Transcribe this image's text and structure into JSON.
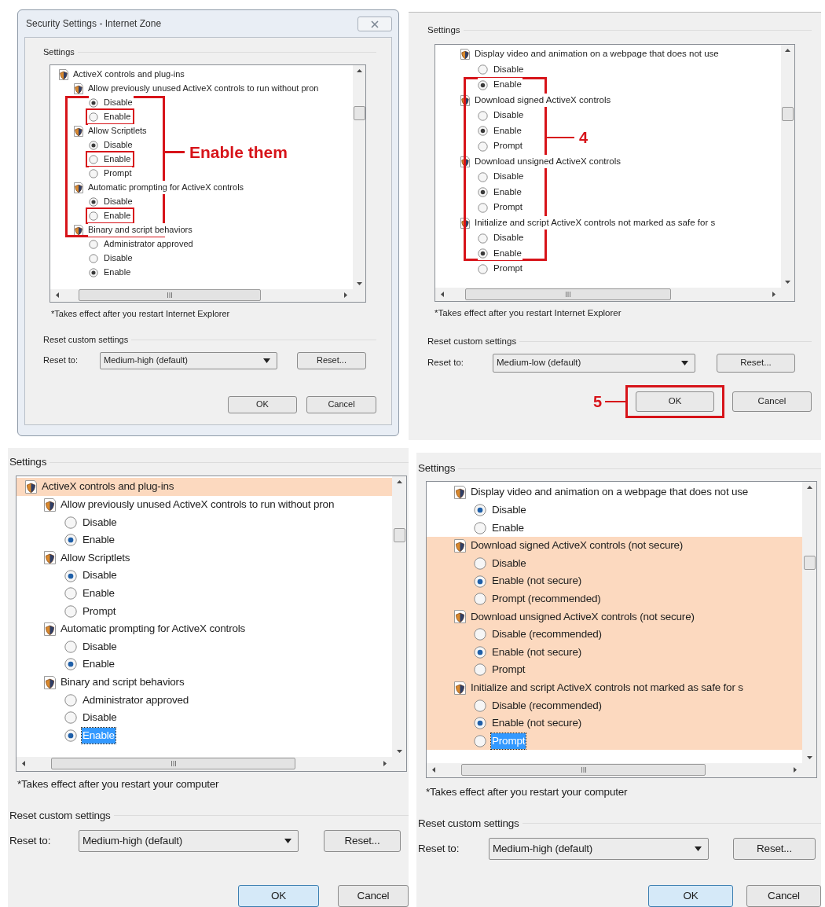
{
  "panels": [
    {
      "kind": "dialog",
      "title": "Security Settings - Internet Zone",
      "settings_label": "Settings",
      "tree": [
        {
          "kind": "group",
          "label": "ActiveX controls and plug-ins",
          "children": [
            {
              "kind": "setting",
              "label": "Allow previously unused ActiveX controls to run without pron",
              "children": [
                {
                  "kind": "option",
                  "label": "Disable",
                  "selected": true,
                  "bracket_start": true
                },
                {
                  "kind": "option",
                  "label": "Enable",
                  "selected": false,
                  "outlined": true
                }
              ]
            },
            {
              "kind": "setting",
              "label": "Allow Scriptlets",
              "children": [
                {
                  "kind": "option",
                  "label": "Disable",
                  "selected": true
                },
                {
                  "kind": "option",
                  "label": "Enable",
                  "selected": false,
                  "outlined": true
                },
                {
                  "kind": "option",
                  "label": "Prompt",
                  "selected": false
                }
              ]
            },
            {
              "kind": "setting",
              "label": "Automatic prompting for ActiveX controls",
              "children": [
                {
                  "kind": "option",
                  "label": "Disable",
                  "selected": true
                },
                {
                  "kind": "option",
                  "label": "Enable",
                  "selected": false,
                  "outlined": true
                }
              ]
            },
            {
              "kind": "setting",
              "label": "Binary and script behaviors",
              "bracket_end": true,
              "children": [
                {
                  "kind": "option",
                  "label": "Administrator approved",
                  "selected": false
                },
                {
                  "kind": "option",
                  "label": "Disable",
                  "selected": false
                },
                {
                  "kind": "option",
                  "label": "Enable",
                  "selected": true
                }
              ]
            }
          ]
        }
      ],
      "annotation": "Enable them",
      "note": "*Takes effect after you restart Internet Explorer",
      "reset_group": "Reset custom settings",
      "reset_label": "Reset to:",
      "reset_level": "Medium-high (default)",
      "reset_button": "Reset...",
      "ok": {
        "label": "OK",
        "default": false
      },
      "cancel": "Cancel"
    },
    {
      "kind": "pane",
      "settings_label": "Settings",
      "tree": [
        {
          "kind": "setting",
          "label": "Display video and animation on a webpage that does not use",
          "children": [
            {
              "kind": "option",
              "label": "Disable",
              "selected": false
            },
            {
              "kind": "option",
              "label": "Enable",
              "selected": true,
              "bracket_start": true
            }
          ]
        },
        {
          "kind": "setting",
          "label": "Download signed ActiveX controls",
          "children": [
            {
              "kind": "option",
              "label": "Disable",
              "selected": false
            },
            {
              "kind": "option",
              "label": "Enable",
              "selected": true
            },
            {
              "kind": "option",
              "label": "Prompt",
              "selected": false
            }
          ]
        },
        {
          "kind": "setting",
          "label": "Download unsigned ActiveX controls",
          "children": [
            {
              "kind": "option",
              "label": "Disable",
              "selected": false
            },
            {
              "kind": "option",
              "label": "Enable",
              "selected": true
            },
            {
              "kind": "option",
              "label": "Prompt",
              "selected": false
            }
          ]
        },
        {
          "kind": "setting",
          "label": "Initialize and script ActiveX controls not marked as safe for s",
          "children": [
            {
              "kind": "option",
              "label": "Disable",
              "selected": false
            },
            {
              "kind": "option",
              "label": "Enable",
              "selected": true,
              "bracket_end": true
            },
            {
              "kind": "option",
              "label": "Prompt",
              "selected": false
            }
          ]
        }
      ],
      "annotation": "4",
      "note": "*Takes effect after you restart Internet Explorer",
      "reset_group": "Reset custom settings",
      "reset_label": "Reset to:",
      "reset_level": "Medium-low (default)",
      "reset_button": "Reset...",
      "ok": {
        "label": "OK",
        "default": false,
        "annotation": "5"
      },
      "cancel": "Cancel"
    },
    {
      "kind": "pane",
      "settings_label": "Settings",
      "tree": [
        {
          "kind": "group",
          "label": "ActiveX controls and plug-ins",
          "highlighted": true,
          "children": [
            {
              "kind": "setting",
              "label": "Allow previously unused ActiveX controls to run without pron",
              "highlighted": false,
              "children": [
                {
                  "kind": "option",
                  "label": "Disable",
                  "selected": false,
                  "highlighted": false
                },
                {
                  "kind": "option",
                  "label": "Enable",
                  "selected": true,
                  "highlighted": false
                }
              ]
            },
            {
              "kind": "setting",
              "label": "Allow Scriptlets",
              "highlighted": false,
              "children": [
                {
                  "kind": "option",
                  "label": "Disable",
                  "selected": true,
                  "highlighted": false
                },
                {
                  "kind": "option",
                  "label": "Enable",
                  "selected": false,
                  "highlighted": false
                },
                {
                  "kind": "option",
                  "label": "Prompt",
                  "selected": false,
                  "highlighted": false
                }
              ]
            },
            {
              "kind": "setting",
              "label": "Automatic prompting for ActiveX controls",
              "highlighted": false,
              "children": [
                {
                  "kind": "option",
                  "label": "Disable",
                  "selected": false,
                  "highlighted": false
                },
                {
                  "kind": "option",
                  "label": "Enable",
                  "selected": true,
                  "highlighted": false
                }
              ]
            },
            {
              "kind": "setting",
              "label": "Binary and script behaviors",
              "highlighted": false,
              "children": [
                {
                  "kind": "option",
                  "label": "Administrator approved",
                  "selected": false,
                  "highlighted": false
                },
                {
                  "kind": "option",
                  "label": "Disable",
                  "selected": false,
                  "highlighted": false
                },
                {
                  "kind": "option",
                  "label": "Enable",
                  "selected": true,
                  "highlighted": false,
                  "focused": true
                }
              ]
            }
          ]
        }
      ],
      "note": "*Takes effect after you restart your computer",
      "reset_group": "Reset custom settings",
      "reset_label": "Reset to:",
      "reset_level": "Medium-high (default)",
      "reset_button": "Reset...",
      "ok": {
        "label": "OK",
        "default": true
      },
      "cancel": "Cancel"
    },
    {
      "kind": "pane",
      "settings_label": "Settings",
      "tree": [
        {
          "kind": "setting",
          "label": "Display video and animation on a webpage that does not use",
          "highlighted": false,
          "children": [
            {
              "kind": "option",
              "label": "Disable",
              "selected": true,
              "highlighted": false
            },
            {
              "kind": "option",
              "label": "Enable",
              "selected": false,
              "highlighted": false
            }
          ]
        },
        {
          "kind": "setting",
          "label": "Download signed ActiveX controls (not secure)",
          "highlighted": true,
          "children": [
            {
              "kind": "option",
              "label": "Disable",
              "selected": false,
              "highlighted": true
            },
            {
              "kind": "option",
              "label": "Enable (not secure)",
              "selected": true,
              "highlighted": true
            },
            {
              "kind": "option",
              "label": "Prompt (recommended)",
              "selected": false,
              "highlighted": true
            }
          ]
        },
        {
          "kind": "setting",
          "label": "Download unsigned ActiveX controls (not secure)",
          "highlighted": true,
          "children": [
            {
              "kind": "option",
              "label": "Disable (recommended)",
              "selected": false,
              "highlighted": true
            },
            {
              "kind": "option",
              "label": "Enable (not secure)",
              "selected": true,
              "highlighted": true
            },
            {
              "kind": "option",
              "label": "Prompt",
              "selected": false,
              "highlighted": true
            }
          ]
        },
        {
          "kind": "setting",
          "label": "Initialize and script ActiveX controls not marked as safe for s",
          "highlighted": true,
          "children": [
            {
              "kind": "option",
              "label": "Disable (recommended)",
              "selected": false,
              "highlighted": true
            },
            {
              "kind": "option",
              "label": "Enable (not secure)",
              "selected": true,
              "highlighted": true
            },
            {
              "kind": "option",
              "label": "Prompt",
              "selected": false,
              "highlighted": true,
              "focused": true
            }
          ]
        }
      ],
      "note": "*Takes effect after you restart your computer",
      "reset_group": "Reset custom settings",
      "reset_label": "Reset to:",
      "reset_level": "Medium-high (default)",
      "reset_button": "Reset...",
      "ok": {
        "label": "OK",
        "default": true
      },
      "cancel": "Cancel"
    }
  ]
}
